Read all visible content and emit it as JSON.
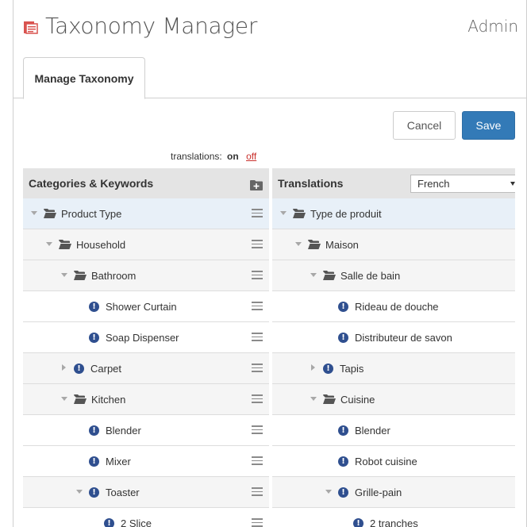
{
  "app": {
    "title": "Taxonomy Manager",
    "admin_label": "Admin",
    "colors": {
      "logo": "#d9534f",
      "primary": "#337ab7",
      "off_link": "#c9302c",
      "alert_icon": "#2f4f8f"
    }
  },
  "tabs": [
    {
      "label": "Manage Taxonomy",
      "active": true
    }
  ],
  "actions": {
    "cancel_label": "Cancel",
    "save_label": "Save"
  },
  "translations_toggle": {
    "label": "translations:",
    "on_label": "on",
    "off_label": "off"
  },
  "left_panel": {
    "title": "Categories & Keywords",
    "add_icon": "add-folder-icon",
    "rows": [
      {
        "label": "Product Type",
        "depth": 0,
        "kind": "folder",
        "expander": "down"
      },
      {
        "label": "Household",
        "depth": 1,
        "kind": "folder",
        "expander": "down"
      },
      {
        "label": "Bathroom",
        "depth": 2,
        "kind": "folder",
        "expander": "down"
      },
      {
        "label": "Shower Curtain",
        "depth": 3,
        "kind": "keyword",
        "expander": "none"
      },
      {
        "label": "Soap Dispenser",
        "depth": 3,
        "kind": "keyword",
        "expander": "none"
      },
      {
        "label": "Carpet",
        "depth": 2,
        "kind": "keyword",
        "expander": "right"
      },
      {
        "label": "Kitchen",
        "depth": 2,
        "kind": "folder",
        "expander": "down"
      },
      {
        "label": "Blender",
        "depth": 3,
        "kind": "keyword",
        "expander": "none"
      },
      {
        "label": "Mixer",
        "depth": 3,
        "kind": "keyword",
        "expander": "none"
      },
      {
        "label": "Toaster",
        "depth": 3,
        "kind": "keyword",
        "expander": "down"
      },
      {
        "label": "2 Slice",
        "depth": 4,
        "kind": "keyword",
        "expander": "none"
      }
    ]
  },
  "right_panel": {
    "title": "Translations",
    "language_selected": "French",
    "rows": [
      {
        "label": "Type de produit",
        "depth": 0,
        "kind": "folder",
        "expander": "down"
      },
      {
        "label": "Maison",
        "depth": 1,
        "kind": "folder",
        "expander": "down"
      },
      {
        "label": "Salle de bain",
        "depth": 2,
        "kind": "folder",
        "expander": "down"
      },
      {
        "label": "Rideau de douche",
        "depth": 3,
        "kind": "keyword",
        "expander": "none"
      },
      {
        "label": "Distributeur de savon",
        "depth": 3,
        "kind": "keyword",
        "expander": "none"
      },
      {
        "label": "Tapis",
        "depth": 2,
        "kind": "keyword",
        "expander": "right"
      },
      {
        "label": "Cuisine",
        "depth": 2,
        "kind": "folder",
        "expander": "down"
      },
      {
        "label": "Blender",
        "depth": 3,
        "kind": "keyword",
        "expander": "none"
      },
      {
        "label": "Robot cuisine",
        "depth": 3,
        "kind": "keyword",
        "expander": "none"
      },
      {
        "label": "Grille-pain",
        "depth": 3,
        "kind": "keyword",
        "expander": "down"
      },
      {
        "label": "2 tranches",
        "depth": 4,
        "kind": "keyword",
        "expander": "none"
      }
    ]
  }
}
